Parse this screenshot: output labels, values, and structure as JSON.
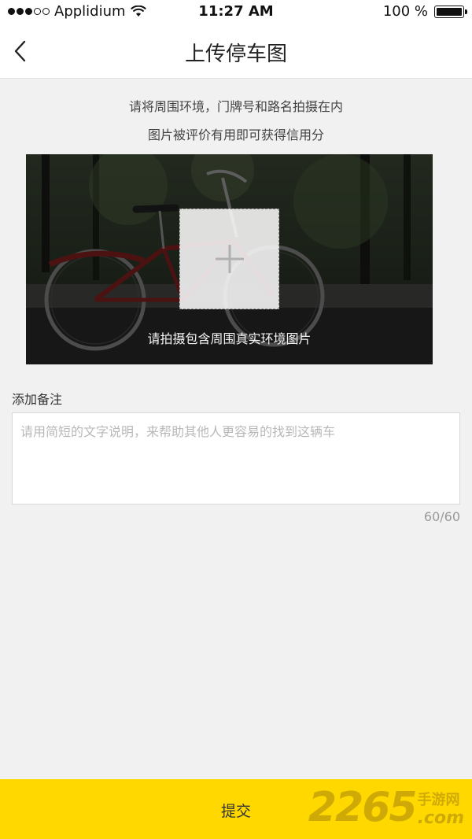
{
  "status_bar": {
    "carrier": "Applidium",
    "time": "11:27 AM",
    "battery": "100 %",
    "battery_level": 1.0
  },
  "nav": {
    "title": "上传停车图",
    "back_icon": "chevron-left-icon"
  },
  "instructions": {
    "line1": "请将周围环境，门牌号和路名拍摄在内",
    "line2": "图片被评价有用即可获得信用分"
  },
  "photo": {
    "hint": "请拍摄包含周围真实环境图片",
    "add_icon": "plus-icon"
  },
  "remark": {
    "label": "添加备注",
    "placeholder": "请用简短的文字说明，来帮助其他人更容易的找到这辆车",
    "value": "",
    "counter": "60/60"
  },
  "submit": {
    "label": "提交",
    "accent": "#ffd800"
  },
  "watermark": {
    "number": "2265",
    "site_cn": "手游网",
    "site_com": ".com"
  }
}
